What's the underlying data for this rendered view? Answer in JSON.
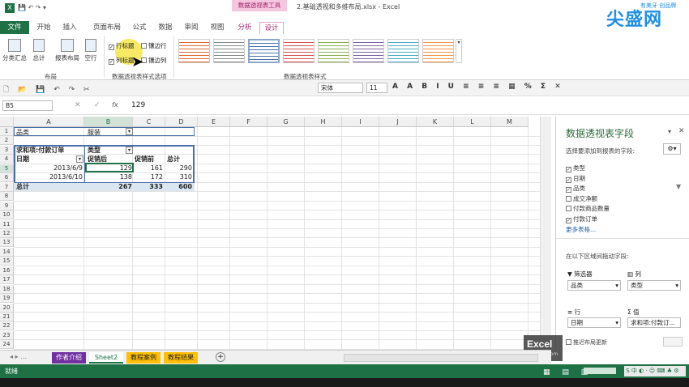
{
  "window": {
    "title": "2.基础透视和多维布局.xlsx - Excel",
    "context_tab": "数据透视表工具"
  },
  "tabs": {
    "file": "文件",
    "home": "开始",
    "insert": "插入",
    "layout": "页面布局",
    "formulas": "公式",
    "data": "数据",
    "review": "审阅",
    "view": "视图",
    "analyze": "分析",
    "design": "设计"
  },
  "ribbon": {
    "subtotal": "分类汇总",
    "grandtotal": "总计",
    "report_layout": "报表布局",
    "blank_row": "空行",
    "layout_group": "布局",
    "row_headers": "行标题",
    "banded_rows": "镶边行",
    "col_headers": "列标题",
    "banded_cols": "镶边列",
    "style_options_group": "数据透视表样式选项",
    "styles_group": "数据透视表样式"
  },
  "toolbar": {
    "font": "宋体",
    "size": "11"
  },
  "formula": {
    "namebox": "B5",
    "fx": "fx",
    "value": "129"
  },
  "columns": [
    "A",
    "B",
    "C",
    "D",
    "E",
    "F",
    "G",
    "H",
    "I",
    "J",
    "K",
    "L",
    "M"
  ],
  "rows": [
    "1",
    "2",
    "3",
    "4",
    "5",
    "6",
    "7",
    "8",
    "9",
    "10",
    "11",
    "12",
    "13",
    "14",
    "15",
    "16",
    "17",
    "18",
    "19",
    "20",
    "21",
    "22",
    "23",
    "24"
  ],
  "pivot": {
    "filter_label": "品类",
    "filter_value": "服装",
    "sum_label": "求和项:付款订单",
    "type_label": "类型",
    "date_label": "日期",
    "col1": "促销后",
    "col2": "促销前",
    "col3": "总计",
    "r1_date": "2013/6/9",
    "r1_v1": "129",
    "r1_v2": "161",
    "r1_v3": "290",
    "r2_date": "2013/6/10",
    "r2_v1": "138",
    "r2_v2": "172",
    "r2_v3": "310",
    "total_label": "总计",
    "t_v1": "267",
    "t_v2": "333",
    "t_v3": "600"
  },
  "panel": {
    "title": "数据透视表字段",
    "subtitle": "选择要添加到报表的字段:",
    "fields": [
      {
        "name": "类型",
        "checked": true
      },
      {
        "name": "日期",
        "checked": true
      },
      {
        "name": "品类",
        "checked": true
      },
      {
        "name": "成交净额",
        "checked": false
      },
      {
        "name": "付款商品数量",
        "checked": false
      },
      {
        "name": "付款订单",
        "checked": true
      }
    ],
    "more": "更多表格...",
    "drag_label": "在以下区域间拖动字段:",
    "filters": "筛选器",
    "columns": "列",
    "rows": "行",
    "values": "值",
    "filter_item": "品类",
    "column_item": "类型",
    "row_item": "日期",
    "value_item": "求和项:付款订...",
    "defer": "推迟布局更新"
  },
  "sheets": [
    "作者介绍",
    "Sheet2",
    "教程案例",
    "教程结果"
  ],
  "status": {
    "ready": "就绪"
  },
  "watermark": {
    "brand": "尖盛网",
    "slogan": "有美牙 创品牌",
    "excel": "Excel",
    "site": "520.com"
  }
}
